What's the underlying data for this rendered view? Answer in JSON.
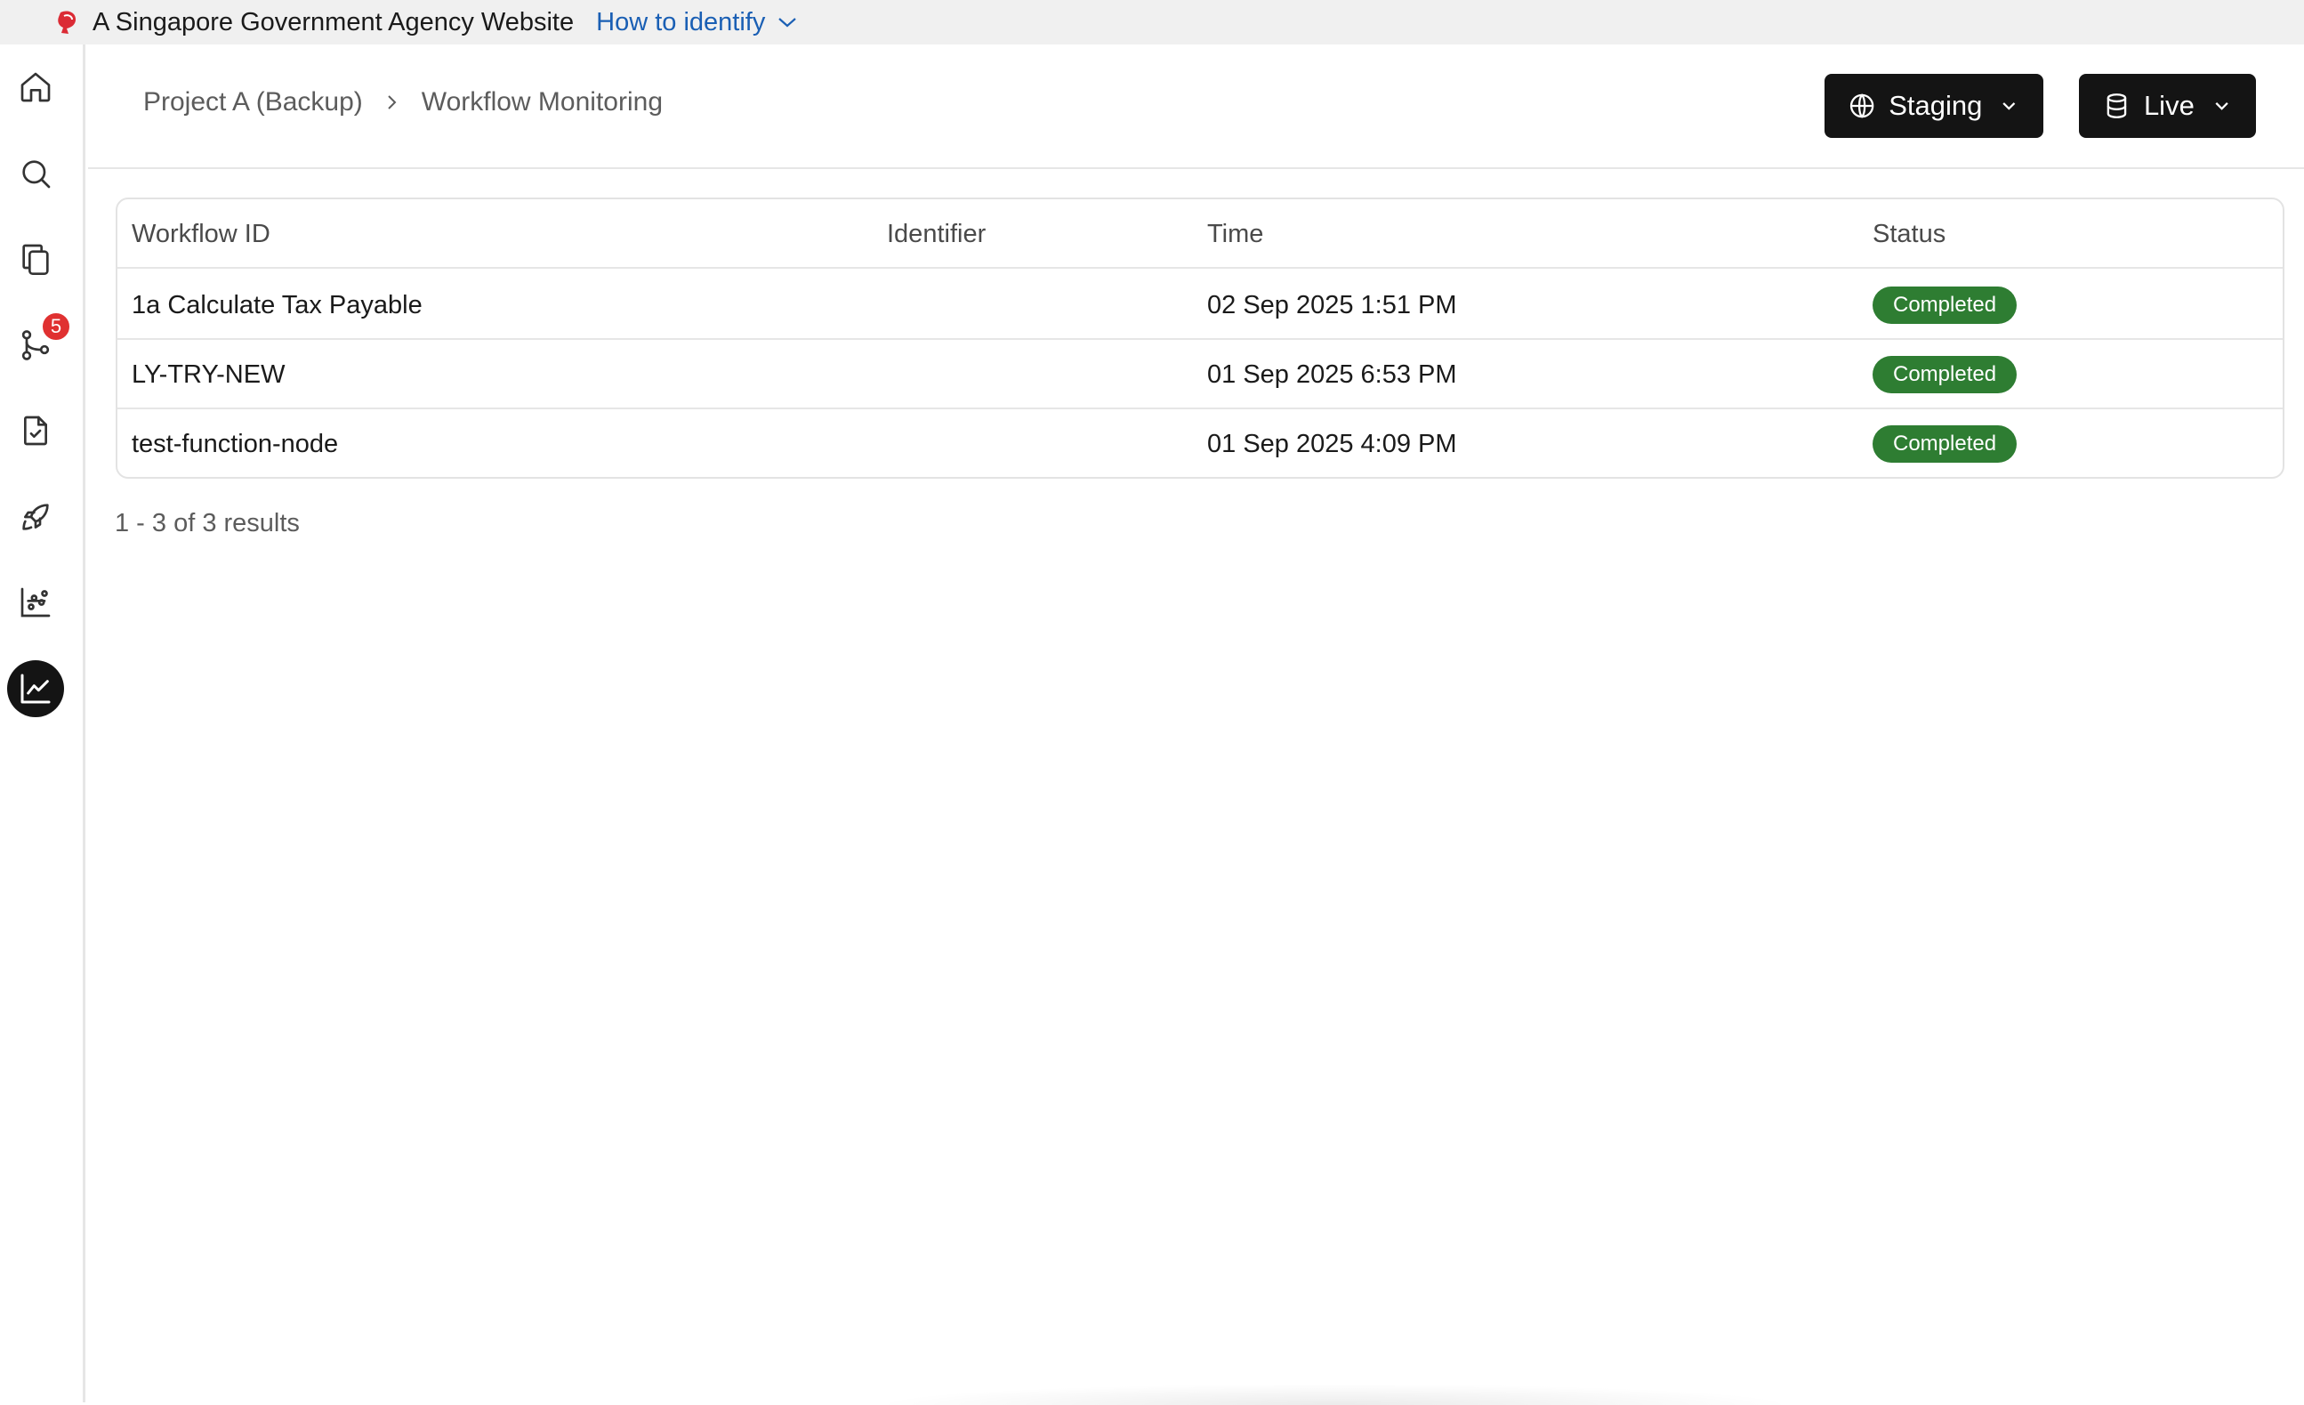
{
  "masthead": {
    "text": "A Singapore Government Agency Website",
    "identify_link": "How to identify"
  },
  "sidebar": {
    "items": [
      {
        "icon": "home-icon"
      },
      {
        "icon": "search-icon"
      },
      {
        "icon": "copy-icon"
      },
      {
        "icon": "git-branch-icon",
        "badge": "5"
      },
      {
        "icon": "file-check-icon"
      },
      {
        "icon": "rocket-icon"
      },
      {
        "icon": "scatter-chart-icon"
      },
      {
        "icon": "line-chart-icon",
        "active": true
      }
    ]
  },
  "breadcrumb": {
    "items": [
      "Project A (Backup)",
      "Workflow Monitoring"
    ]
  },
  "env": {
    "staging_label": "Staging",
    "live_label": "Live"
  },
  "table": {
    "columns": [
      "Workflow ID",
      "Identifier",
      "Time",
      "Status"
    ],
    "rows": [
      {
        "workflow_id": "1a Calculate Tax Payable",
        "identifier": "",
        "time": "02 Sep 2025 1:51 PM",
        "status": "Completed"
      },
      {
        "workflow_id": "LY-TRY-NEW",
        "identifier": "",
        "time": "01 Sep 2025 6:53 PM",
        "status": "Completed"
      },
      {
        "workflow_id": "test-function-node",
        "identifier": "",
        "time": "01 Sep 2025 4:09 PM",
        "status": "Completed"
      }
    ]
  },
  "pagination": {
    "results_text": "1 - 3 of 3 results"
  },
  "colors": {
    "status_completed": "#2e7d32",
    "button_dark": "#141414",
    "badge_red": "#e03131",
    "link_blue": "#1a5fb4"
  }
}
